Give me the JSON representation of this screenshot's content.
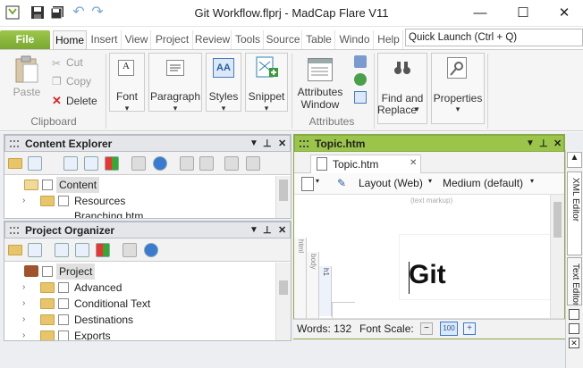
{
  "window": {
    "title": "Git Workflow.flprj - MadCap Flare V11",
    "controls": {
      "minimize": "—",
      "maximize": "☐",
      "close": "✕"
    }
  },
  "quick_access": {
    "save": "💾",
    "save_all": "💾",
    "undo": "↶",
    "redo": "↷"
  },
  "ribbon_tabs": [
    {
      "label": "File"
    },
    {
      "label": "Home"
    },
    {
      "label": "Insert"
    },
    {
      "label": "View"
    },
    {
      "label": "Project"
    },
    {
      "label": "Review"
    },
    {
      "label": "Tools"
    },
    {
      "label": "Source"
    },
    {
      "label": "Table"
    },
    {
      "label": "Windo"
    },
    {
      "label": "Help"
    }
  ],
  "quick_launch": {
    "placeholder": "Quick Launch (Ctrl + Q)"
  },
  "ribbon": {
    "clipboard": {
      "paste": "Paste",
      "cut": "Cut",
      "copy": "Copy",
      "delete": "Delete",
      "group": "Clipboard"
    },
    "font": "Font",
    "paragraph": "Paragraph",
    "styles": "Styles",
    "snippet": "Snippet",
    "attributes_window_line1": "Attributes",
    "attributes_window_line2": "Window",
    "attributes_group": "Attributes",
    "find_replace_line1": "Find and",
    "find_replace_line2": "Replace",
    "properties": "Properties",
    "dropdown_arrow": "▾"
  },
  "content_explorer": {
    "title": "Content Explorer",
    "items": [
      {
        "label": "Content"
      },
      {
        "label": "Resources"
      },
      {
        "label": "Branching.htm"
      }
    ]
  },
  "project_organizer": {
    "title": "Project Organizer",
    "items": [
      {
        "label": "Project"
      },
      {
        "label": "Advanced"
      },
      {
        "label": "Conditional Text"
      },
      {
        "label": "Destinations"
      },
      {
        "label": "Exports"
      }
    ]
  },
  "editor": {
    "panel_title": "Topic.htm",
    "doc_tab": "Topic.htm",
    "layout": "Layout (Web)",
    "medium": "Medium (default)",
    "text_markup": "(text markup)",
    "structure_bars": {
      "html": "html",
      "body": "body",
      "h1": "h1"
    },
    "heading": "Git",
    "side_tabs": {
      "xml_editor": "XML Editor",
      "text_editor": "Text Editor"
    }
  },
  "status": {
    "words": "Words: 132",
    "font_scale": "Font Scale:"
  },
  "colors": {
    "accent_green": "#9bc54a",
    "file_tab": "#7ba832"
  }
}
